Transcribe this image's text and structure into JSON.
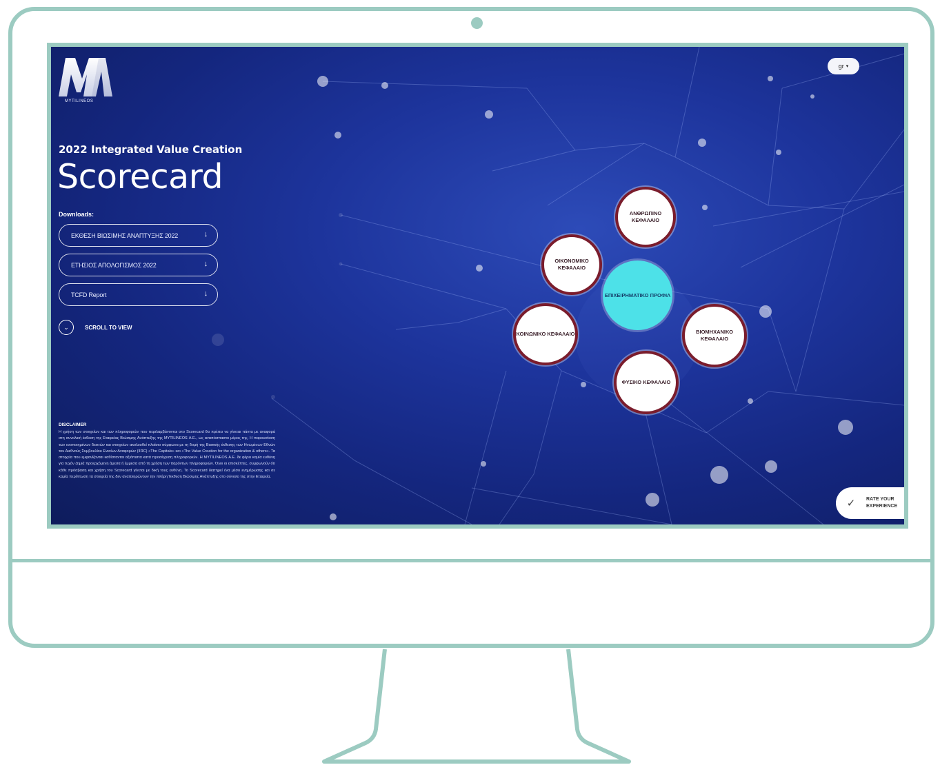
{
  "site": {
    "logo_text": "MYTILINEOS",
    "subtitle": "2022 Integrated Value Creation",
    "title": "Scorecard",
    "language": "gr"
  },
  "downloads": {
    "label": "Downloads:",
    "items": [
      {
        "label": "ΕΚΘΕΣΗ ΒΙΩΣΙΜΗΣ ΑΝΑΠΤΥΞΗΣ 2022",
        "icon": "download-arrow"
      },
      {
        "label": "ΕΤΗΣΙΟΣ ΑΠΟΛΟΓΙΣΜΟΣ 2022",
        "icon": "download-arrow"
      },
      {
        "label": "TCFD Report",
        "icon": "download-arrow"
      }
    ]
  },
  "scroll": {
    "label": "SCROLL TO VIEW",
    "icon": "chevron-down-icon"
  },
  "disclaimer": {
    "title": "DISCLAIMER",
    "text": "Η χρήση των στοιχείων και των πληροφοριών που περιλαμβάνονται στο Scorecard θα πρέπει να γίνεται πάντα με αναφορά στη συνολική έκθεση της Εταιρείας Βιώσιμης Ανάπτυξης της MYTILINEOS Α.Ε., ως αναπόσπαστο μέρος της. Η παρουσίαση των ενοποιημένων δεικτών και στοιχείων ακολουθεί πλαίσιο σύμφωνα με τη δομή της Βασικής έκθεσης των Ηνωμένων Εθνών του Διεθνούς Συμβουλίου Ενιαίων Αναφορών (IIRC) «The Capitals» και «The Value Creation for the organization & others». Τα στοιχεία που εμφανίζονται καθίστανται αξιόπιστα κατά προσέγγιση πληροφοριών. Η MYTILINEOS Α.Ε. δε φέρει καμία ευθύνη για τυχόν ζημιά προερχόμενη άμεσα ή έμμεσα από τη χρήση των παρόντων πληροφοριών. Όλοι οι επισκέπτες, συμφωνούν ότι κάθε πρόσβαση και χρήση του Scorecard γίνεται με δική τους ευθύνη. Το Scorecard διατηρεί ένα μέσο ενημέρωσης και σε καμία περίπτωση τα στοιχεία της δεν αναπληρώνουν την πλήρη Έκθεση Βιώσιμης Ανάπτυξης στο σύνολο της στην Εταιρεία."
  },
  "capitals": {
    "center": "ΕΠΙΧΕΙΡΗΜΑΤΙΚΟ ΠΡΟΦΙΛ",
    "nodes": {
      "human": "ΑΝΘΡΩΠΙΝΟ ΚΕΦΑΛΑΙΟ",
      "financial": "ΟΙΚΟΝΟΜΙΚΟ ΚΕΦΑΛΑΙΟ",
      "social": "ΚΟΙΝΩΝΙΚΟ ΚΕΦΑΛΑΙΟ",
      "industrial": "ΒΙΟΜΗΧΑΝΙΚΟ ΚΕΦΑΛΑΙΟ",
      "natural": "ΦΥΣΙΚΟ ΚΕΦΑΛΑΙΟ"
    }
  },
  "rate": {
    "label": "RATE YOUR EXPERIENCE",
    "icon": "check-circle-icon"
  },
  "colors": {
    "background": "#14267e",
    "node_border": "#7a1c2c",
    "center_node": "#4de1e8",
    "device_outline": "#9ccbc1"
  }
}
